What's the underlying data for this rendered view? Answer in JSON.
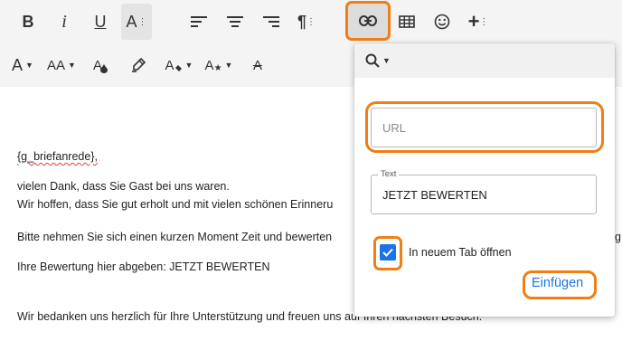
{
  "toolbar_top": {
    "bold_label": "B",
    "italic_label": "i",
    "underline_label": "U",
    "fontsize_label": "A",
    "paragraph_label": "¶",
    "insert_label": "+",
    "icons": [
      "bold-icon",
      "italic-icon",
      "underline-icon",
      "font-size-icon",
      "align-left-icon",
      "align-center-icon",
      "align-right-icon",
      "paragraph-icon",
      "link-icon",
      "table-icon",
      "emoji-icon",
      "insert-plus-icon"
    ]
  },
  "toolbar_second": {
    "font_family_label": "A",
    "font_size_label": "AA",
    "text_color_label": "A",
    "bg_color_label": "A",
    "special_label": "A",
    "clear_label": "A"
  },
  "editor": {
    "lines": [
      "{g_briefanrede},",
      "vielen Dank, dass Sie Gast bei uns waren.",
      "Wir hoffen, dass Sie gut erholt und mit vielen schönen Erinneru",
      "Bitte nehmen Sie sich einen kurzen Moment Zeit und bewerten",
      "Ihre Bewertung hier abgeben: JETZT BEWERTEN",
      "Wir bedanken uns herzlich für Ihre Unterstützung und freuen uns auf Ihren nächsten Besuch."
    ],
    "right_fragment": "g"
  },
  "link_popup": {
    "url_placeholder": "URL",
    "url_value": "",
    "text_legend": "Text",
    "text_value": "JETZT BEWERTEN",
    "open_new_tab_label": "In neuem Tab öffnen",
    "open_new_tab_checked": true,
    "insert_button": "Einfügen"
  },
  "colors": {
    "highlight": "#f07d16",
    "accent": "#1a73e8"
  }
}
